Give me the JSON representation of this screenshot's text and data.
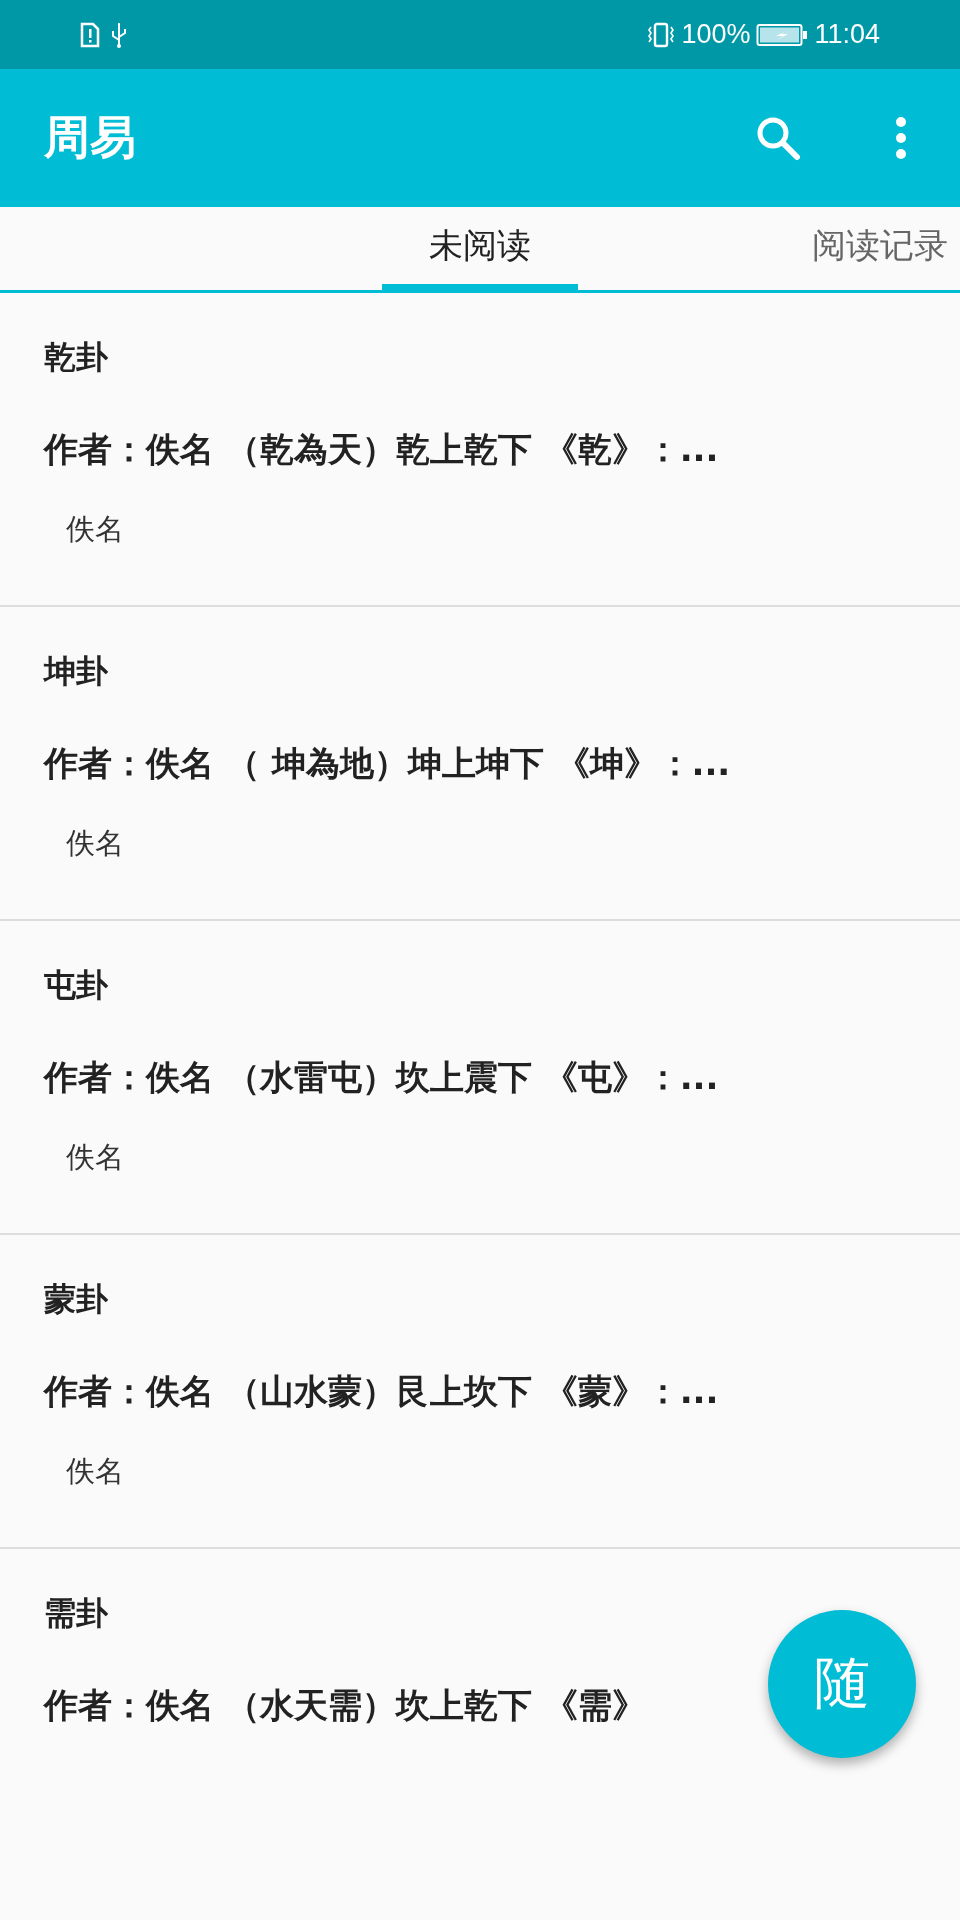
{
  "status_bar": {
    "battery": "100%",
    "time": "11:04"
  },
  "app_bar": {
    "title": "周易"
  },
  "tabs": [
    {
      "label": "未阅读",
      "selected": true
    },
    {
      "label": "阅读记录",
      "selected": false
    }
  ],
  "items": [
    {
      "title": "乾卦",
      "summary": "作者：佚名 （乾為天）乾上乾下 《乾》：...",
      "author": "佚名"
    },
    {
      "title": "坤卦",
      "summary": "作者：佚名 （ 坤為地）坤上坤下 《坤》：...",
      "author": "佚名"
    },
    {
      "title": "屯卦",
      "summary": "作者：佚名 （水雷屯）坎上震下 《屯》：...",
      "author": "佚名"
    },
    {
      "title": "蒙卦",
      "summary": "作者：佚名 （山水蒙）艮上坎下 《蒙》：...",
      "author": "佚名"
    },
    {
      "title": "需卦",
      "summary": "作者：佚名 （水天需）坎上乾下 《需》"
    }
  ],
  "fab": {
    "label": "随"
  }
}
